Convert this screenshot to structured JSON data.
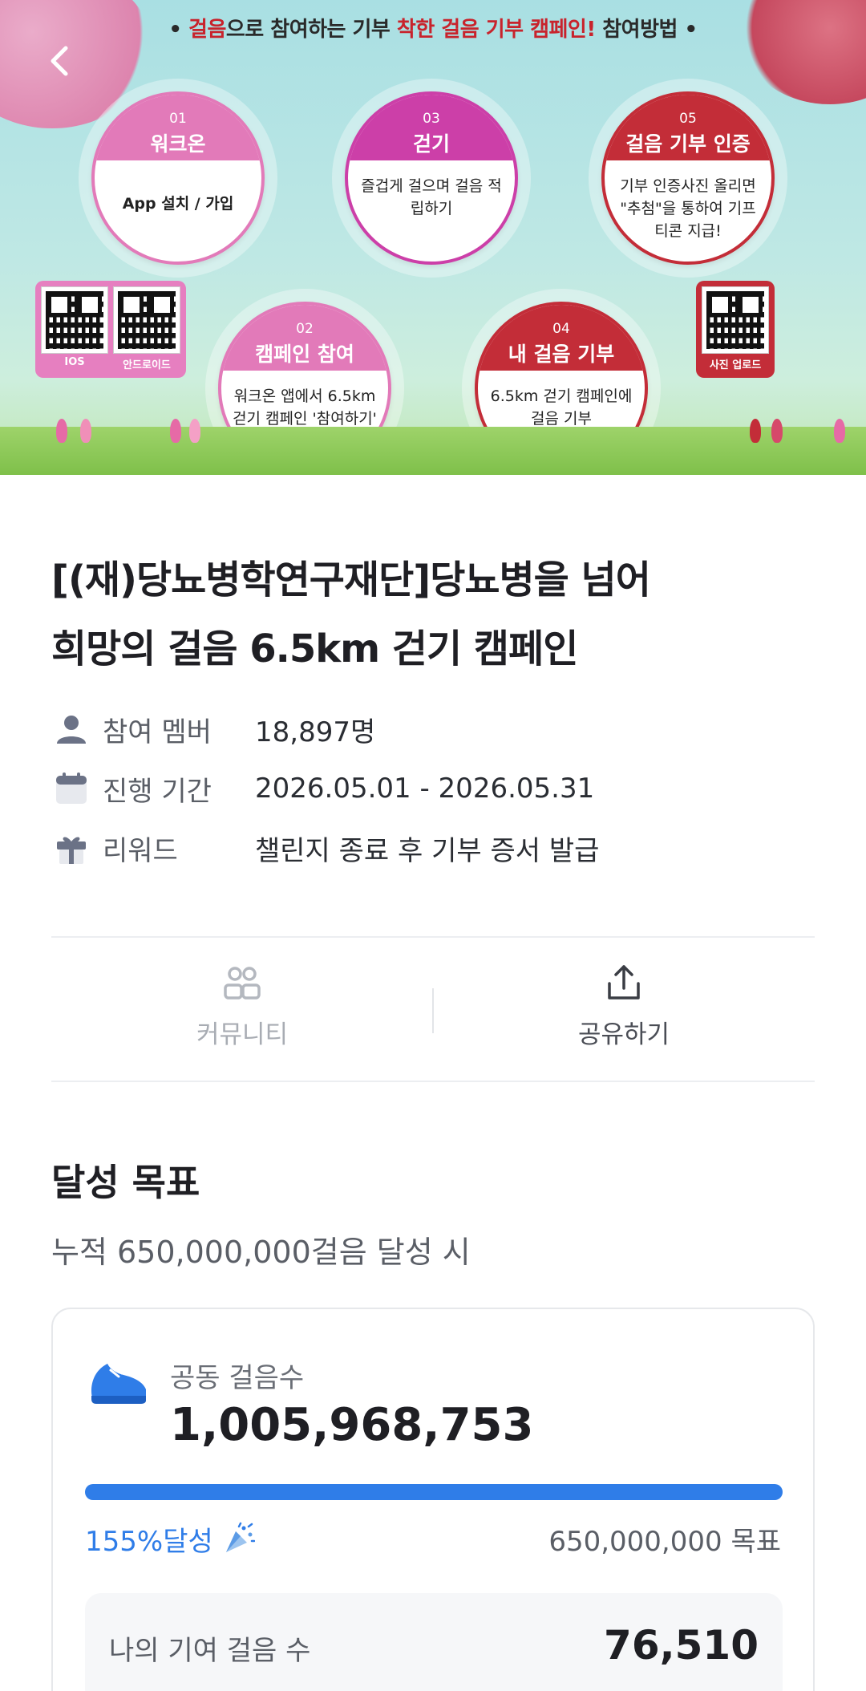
{
  "banner": {
    "headline_parts": [
      "• ",
      "걸음",
      "으로 참여하는 기부 ",
      "착한 걸음 기부 캠페인!",
      " 참여방법 •"
    ],
    "steps": [
      {
        "num": "01",
        "title": "워크온",
        "body": "App 설치 / 가입"
      },
      {
        "num": "02",
        "title": "캠페인 참여",
        "body": "워크온 앱에서 6.5km 걷기 캠페인 '참여하기'"
      },
      {
        "num": "03",
        "title": "걷기",
        "body": "즐겁게 걸으며 걸음 적립하기"
      },
      {
        "num": "04",
        "title": "내 걸음 기부",
        "body": "6.5km 걷기 캠페인에 걸음 기부"
      },
      {
        "num": "05",
        "title": "걸음 기부 인증",
        "body": "기부 인증사진 올리면 \"추첨\"을 통하여 기프티콘 지급!"
      }
    ],
    "qr_labels": [
      "IOS",
      "안드로이드",
      "사진 업로드"
    ]
  },
  "campaign": {
    "title_line1": "[(재)당뇨병학연구재단]당뇨병을 넘어",
    "title_line2": "희망의 걸음 6.5km 걷기 캠페인"
  },
  "info": [
    {
      "icon": "person-icon",
      "label": "참여 멤버",
      "value": "18,897명"
    },
    {
      "icon": "calendar-icon",
      "label": "진행 기간",
      "value": "2026.05.01 - 2026.05.31"
    },
    {
      "icon": "gift-icon",
      "label": "리워드",
      "value": "챌린지 종료 후 기부 증서 발급"
    }
  ],
  "actions": {
    "community_label": "커뮤니티",
    "share_label": "공유하기"
  },
  "goal": {
    "section_title": "달성 목표",
    "subtitle": "누적 650,000,000걸음 달성 시",
    "steps_label": "공동 걸음수",
    "steps_value": "1,005,968,753",
    "progress_fraction": 1.0,
    "percent_label": "155%달성",
    "target_label": "650,000,000 목표",
    "my_label": "나의 기여 걸음 수",
    "my_value": "76,510"
  },
  "colors": {
    "accent_blue": "#2f7de8",
    "brand_red": "#c8232c",
    "step_pink": "#e27ab9",
    "step_magenta": "#cc3fa8",
    "step_red": "#c32d38"
  }
}
